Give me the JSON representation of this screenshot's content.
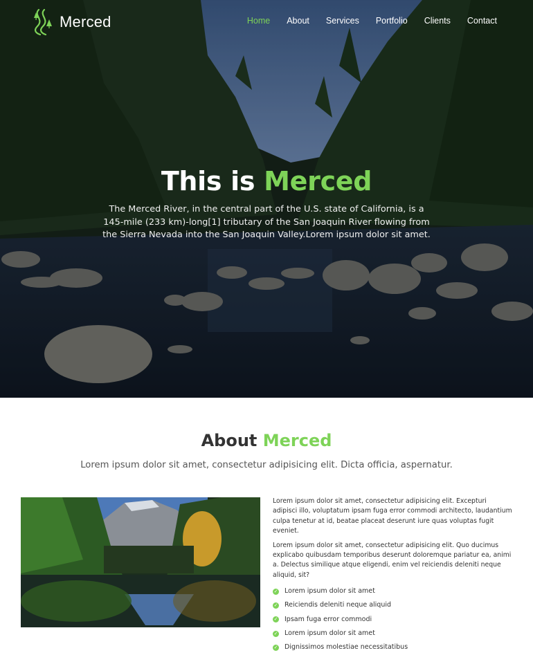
{
  "header": {
    "brand": "Merced",
    "nav": [
      {
        "label": "Home",
        "active": true
      },
      {
        "label": "About",
        "active": false
      },
      {
        "label": "Services",
        "active": false
      },
      {
        "label": "Portfolio",
        "active": false
      },
      {
        "label": "Clients",
        "active": false
      },
      {
        "label": "Contact",
        "active": false
      }
    ]
  },
  "hero": {
    "title_prefix": "This is ",
    "title_accent": "Merced",
    "description": "The Merced River, in the central part of the U.S. state of California, is a 145-mile (233 km)-long[1] tributary of the San Joaquin River flowing from the Sierra Nevada into the San Joaquin Valley.Lorem ipsum dolor sit amet."
  },
  "about": {
    "title_prefix": "About ",
    "title_accent": "Merced",
    "subtitle": "Lorem ipsum dolor sit amet, consectetur adipisicing elit. Dicta officia, aspernatur.",
    "paragraphs": [
      "Lorem ipsum dolor sit amet, consectetur adipisicing elit. Excepturi adipisci illo, voluptatum ipsam fuga error commodi architecto, laudantium culpa tenetur at id, beatae placeat deserunt iure quas voluptas fugit eveniet.",
      "Lorem ipsum dolor sit amet, consectetur adipisicing elit. Quo ducimus explicabo quibusdam temporibus deserunt doloremque pariatur ea, animi a. Delectus similique atque eligendi, enim vel reiciendis deleniti neque aliquid, sit?"
    ],
    "list": [
      "Lorem ipsum dolor sit amet",
      "Reiciendis deleniti neque aliquid",
      "Ipsam fuga error commodi",
      "Lorem ipsum dolor sit amet",
      "Dignissimos molestiae necessitatibus"
    ]
  },
  "colors": {
    "accent": "#7ed358",
    "heading": "#333333",
    "text": "#555555"
  },
  "icons": {
    "logo": "river-trees-icon",
    "list_bullet": "check-circle-icon"
  }
}
